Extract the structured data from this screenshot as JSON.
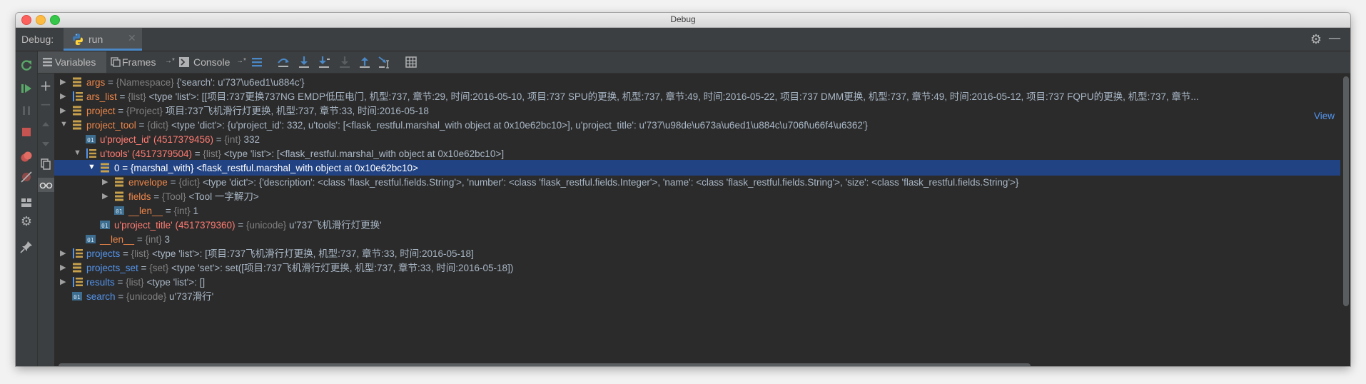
{
  "window": {
    "title": "Debug"
  },
  "tabbar": {
    "label": "Debug:",
    "run_tab": "run"
  },
  "subtoolbar": {
    "variables": "Variables",
    "frames": "Frames",
    "console": "Console"
  },
  "tree": {
    "rows": [
      {
        "name": "args",
        "type": "{Namespace}",
        "value": "{'search': u'737\\u6ed1\\u884c'}"
      },
      {
        "name": "ars_list",
        "type": "{list}",
        "value": "<type 'list'>: [[项目:737更换737NG EMDP低压电门, 机型:737, 章节:29, 时间:2016-05-10, 项目:737 SPU的更换, 机型:737, 章节:49, 时间:2016-05-22, 项目:737 DMM更换, 机型:737, 章节:49, 时间:2016-05-12, 项目:737     FQPU的更换, 机型:737, 章节..."
      },
      {
        "name": "project",
        "type": "{Project}",
        "value": "项目:737飞机滑行灯更换, 机型:737, 章节:33, 时间:2016-05-18"
      },
      {
        "name": "project_tool",
        "type": "{dict}",
        "value": "<type 'dict'>: {u'project_id': 332, u'tools': [<flask_restful.marshal_with object at 0x10e62bc10>], u'project_title': u'737\\u98de\\u673a\\u6ed1\\u884c\\u706f\\u66f4\\u6362'}"
      },
      {
        "name": "u'project_id' (4517379456)",
        "type": "{int}",
        "value": "332"
      },
      {
        "name": "u'tools' (4517379504)",
        "type": "{list}",
        "value": "<type 'list'>: [<flask_restful.marshal_with object at 0x10e62bc10>]"
      },
      {
        "name": "0",
        "type": "{marshal_with}",
        "value": "<flask_restful.marshal_with object at 0x10e62bc10>"
      },
      {
        "name": "envelope",
        "type": "{dict}",
        "value": "<type 'dict'>: {'description': <class 'flask_restful.fields.String'>, 'number': <class 'flask_restful.fields.Integer'>, 'name': <class 'flask_restful.fields.String'>, 'size': <class 'flask_restful.fields.String'>}"
      },
      {
        "name": "fields",
        "type": "{Tool}",
        "value": "<Tool 一字解刀>"
      },
      {
        "name": "__len__",
        "type": "{int}",
        "value": "1"
      },
      {
        "name": "u'project_title' (4517379360)",
        "type": "{unicode}",
        "value": "u'737飞机滑行灯更换'"
      },
      {
        "name": "__len__",
        "type": "{int}",
        "value": "3"
      },
      {
        "name": "projects",
        "type": "{list}",
        "value": "<type 'list'>: [项目:737飞机滑行灯更换, 机型:737, 章节:33, 时间:2016-05-18]"
      },
      {
        "name": "projects_set",
        "type": "{set}",
        "value": "<type 'set'>: set([项目:737飞机滑行灯更换, 机型:737, 章节:33, 时间:2016-05-18])"
      },
      {
        "name": "results",
        "type": "{list}",
        "value": "<type 'list'>: []"
      },
      {
        "name": "search",
        "type": "{unicode}",
        "value": "u'737滑行'"
      }
    ],
    "view_link": "View"
  },
  "colors": {
    "background": "#2b2b2b",
    "toolbar": "#3c3f41",
    "selection": "#214283",
    "variable_name": "#ed864a",
    "dict_key_name": "#ff7b72",
    "special_name": "#5394ec",
    "type_label": "#808080",
    "value_text": "#a9b7c6"
  },
  "icons": {
    "tabbar": [
      "python-icon",
      "close-icon",
      "gear-icon",
      "minimize-icon"
    ],
    "left_toolbar": [
      "rerun-icon",
      "resume-icon",
      "pause-icon",
      "stop-icon",
      "view-breakpoints-icon",
      "mute-breakpoints-icon",
      "restore-layout-icon",
      "settings-icon",
      "pin-icon"
    ],
    "frames_col": [
      "add-watch-icon",
      "remove-watch-icon",
      "up-icon",
      "down-icon",
      "copy-icon",
      "glasses-icon"
    ],
    "subtoolbar": [
      "show-execution-point-icon",
      "step-over-icon",
      "step-into-icon",
      "step-into-my-code-icon",
      "force-step-into-icon",
      "step-out-icon",
      "run-to-cursor-icon",
      "evaluate-expression-icon"
    ],
    "variable_kinds": [
      "field-icon",
      "list-icon",
      "primitive-01-icon"
    ]
  }
}
